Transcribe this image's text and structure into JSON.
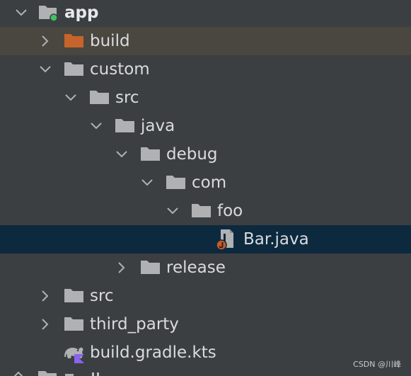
{
  "tree": {
    "items": [
      {
        "label": "app",
        "depth": 0,
        "expanded": true,
        "icon": "module-folder-icon",
        "bold": true
      },
      {
        "label": "build",
        "depth": 1,
        "expanded": false,
        "icon": "excluded-folder-icon"
      },
      {
        "label": "custom",
        "depth": 1,
        "expanded": true,
        "icon": "folder-icon"
      },
      {
        "label": "src",
        "depth": 2,
        "expanded": true,
        "icon": "folder-icon"
      },
      {
        "label": "java",
        "depth": 3,
        "expanded": true,
        "icon": "folder-icon"
      },
      {
        "label": "debug",
        "depth": 4,
        "expanded": true,
        "icon": "folder-icon"
      },
      {
        "label": "com",
        "depth": 5,
        "expanded": true,
        "icon": "folder-icon"
      },
      {
        "label": "foo",
        "depth": 6,
        "expanded": true,
        "icon": "folder-icon"
      },
      {
        "label": "Bar.java",
        "depth": 7,
        "icon": "java-file-icon",
        "selected": true
      },
      {
        "label": "release",
        "depth": 4,
        "expanded": false,
        "icon": "folder-icon"
      },
      {
        "label": "src",
        "depth": 1,
        "expanded": false,
        "icon": "folder-icon"
      },
      {
        "label": "third_party",
        "depth": 1,
        "expanded": false,
        "icon": "folder-icon"
      },
      {
        "label": "build.gradle.kts",
        "depth": 1,
        "icon": "gradle-kotlin-file-icon"
      }
    ]
  },
  "watermark": "CSDN @川峰",
  "colors": {
    "background": "#3c3f41",
    "selected_row": "#0d293e",
    "highlighted_row": "#4a4740",
    "folder": "#afb1b3",
    "excluded_folder": "#c6642c",
    "module_dot": "#3fc464",
    "java_badge": "#c65b28",
    "kotlin_badge": "#8a63f0"
  }
}
